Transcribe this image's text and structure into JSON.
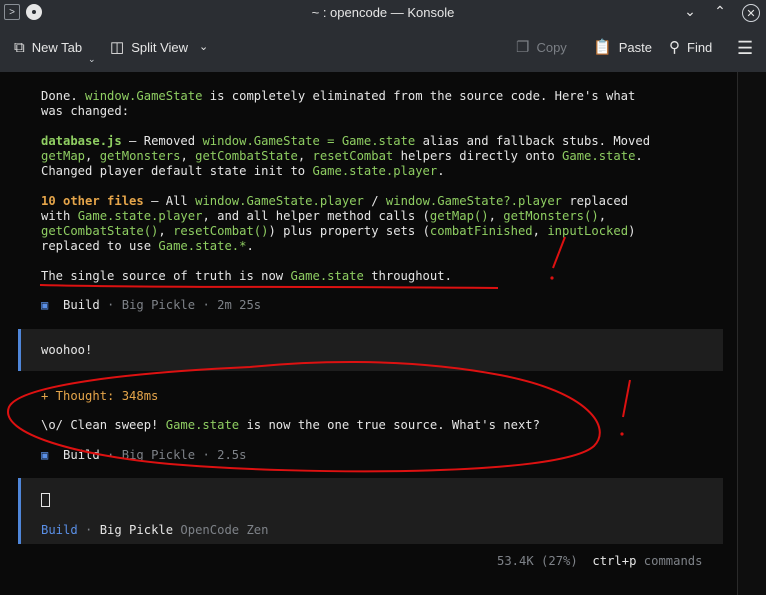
{
  "window": {
    "title": "~ : opencode — Konsole",
    "minimize_icon": "chevron-down-icon",
    "maximize_icon": "chevron-up-icon",
    "close_icon": "close-icon"
  },
  "toolbar": {
    "new_tab": "New Tab",
    "split_view": "Split View",
    "copy": "Copy",
    "paste": "Paste",
    "find": "Find"
  },
  "message1": {
    "line1a": "Done. ",
    "line1b": "window.GameState",
    "line1c": " is completely eliminated from the source code. Here's what",
    "line2": "was changed:",
    "db_file": "database.js",
    "db_a": " — Removed ",
    "db_b": "window.GameState = Game.state",
    "db_c": " alias and fallback stubs. Moved",
    "db2_a": "getMap",
    "db2_b": ", ",
    "db2_c": "getMonsters",
    "db2_d": ", ",
    "db2_e": "getCombatState",
    "db2_f": ", ",
    "db2_g": "resetCombat",
    "db2_h": " helpers directly onto ",
    "db2_i": "Game.state",
    "db2_j": ".",
    "db3_a": "Changed player default state init to ",
    "db3_b": "Game.state.player",
    "db3_c": ".",
    "of_a": "10 other files",
    "of_b": " — All ",
    "of_c": "window.GameState.player",
    "of_d": " / ",
    "of_e": "window.GameState?.player",
    "of_f": " replaced",
    "of2_a": "with ",
    "of2_b": "Game.state.player",
    "of2_c": ", and all helper method calls (",
    "of2_d": "getMap()",
    "of2_e": ", ",
    "of2_f": "getMonsters()",
    "of2_g": ",",
    "of3_a": "getCombatState()",
    "of3_b": ", ",
    "of3_c": "resetCombat()",
    "of3_d": ") plus property sets (",
    "of3_e": "combatFinished",
    "of3_f": ", ",
    "of3_g": "inputLocked",
    "of3_h": ")",
    "of4_a": "replaced to use ",
    "of4_b": "Game.state.*",
    "of4_c": ".",
    "sum_a": "The single source of truth is now ",
    "sum_b": "Game.state",
    "sum_c": " throughout.",
    "build_label": "Build",
    "build_meta": " · Big Pickle · 2m 25s"
  },
  "user_message": "woohoo!",
  "message2": {
    "thought": "+ Thought: 348ms",
    "text_a": "\\o/ Clean sweep! ",
    "text_b": "Game.state",
    "text_c": " is now the one true source. What's next?",
    "build_label": "Build",
    "build_meta": " · Big Pickle · 2.5s"
  },
  "input": {
    "agent": "Build",
    "sep": " · ",
    "model": "Big Pickle",
    "provider": " OpenCode Zen"
  },
  "status": {
    "tokens": "53.4K (27%)",
    "shortcut": "ctrl+p",
    "shortcut_label": " commands"
  }
}
